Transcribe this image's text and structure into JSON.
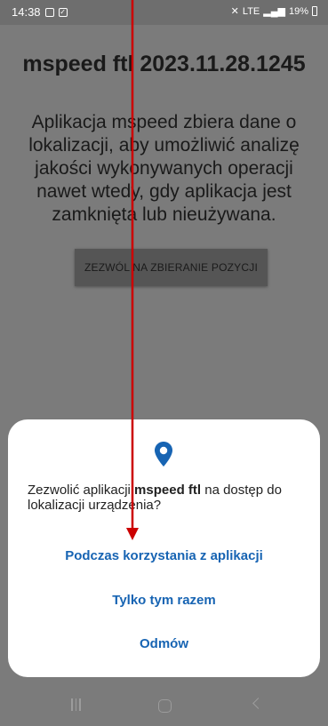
{
  "status_bar": {
    "time": "14:38",
    "signal_text": "LTE",
    "battery": "19%"
  },
  "app": {
    "title": "mspeed ftl 2023.11.28.1245",
    "description": "Aplikacja mspeed zbiera dane o lokalizacji, aby umożliwić analizę jakości wykonywanych operacji nawet wtedy, gdy aplikacja jest zamknięta lub nieużywana.",
    "allow_button": "ZEZWÓL NA ZBIERANIE POZYCJI"
  },
  "dialog": {
    "icon": "location-pin-icon",
    "message_before": "Zezwolić aplikacji ",
    "app_name": "mspeed ftl",
    "message_after": " na dostęp do lokalizacji urządzenia?",
    "options": {
      "while_using": "Podczas korzystania z aplikacji",
      "only_this_time": "Tylko tym razem",
      "deny": "Odmów"
    },
    "accent_color": "#1764b3"
  },
  "annotation": {
    "color": "#cc0000"
  }
}
